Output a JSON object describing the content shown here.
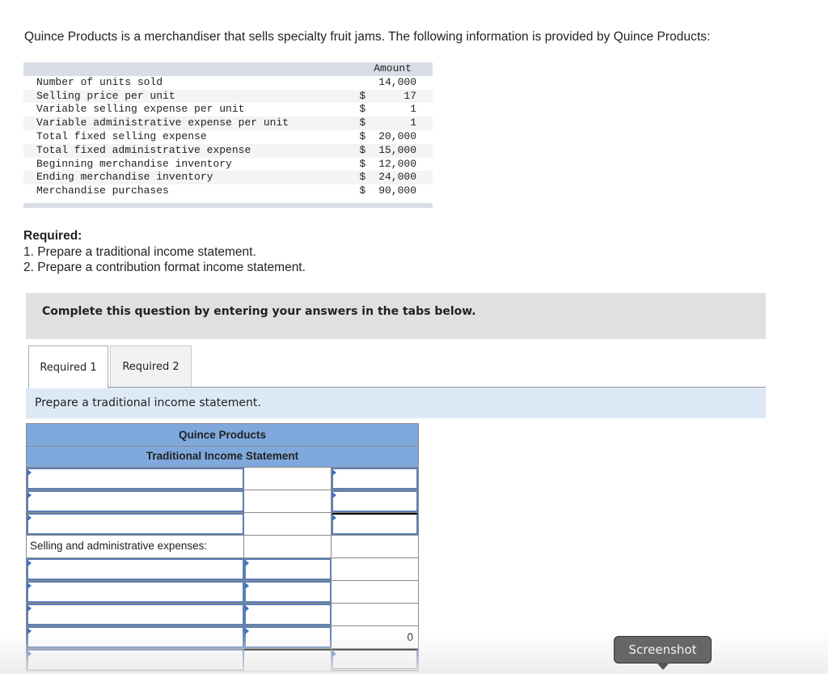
{
  "intro_text": "Quince Products is a merchandiser that sells specialty fruit jams.  The following information is provided by Quince Products:",
  "info_table": {
    "header": "Amount",
    "rows": [
      {
        "label": "Number of units sold",
        "currency": "",
        "value": "14,000"
      },
      {
        "label": "Selling price per unit",
        "currency": "$",
        "value": "17"
      },
      {
        "label": "Variable selling expense per unit",
        "currency": "$",
        "value": "1"
      },
      {
        "label": "Variable administrative expense per unit",
        "currency": "$",
        "value": "1"
      },
      {
        "label": "Total fixed selling expense",
        "currency": "$",
        "value": "20,000"
      },
      {
        "label": "Total fixed administrative expense",
        "currency": "$",
        "value": "15,000"
      },
      {
        "label": "Beginning merchandise inventory",
        "currency": "$",
        "value": "12,000"
      },
      {
        "label": "Ending merchandise inventory",
        "currency": "$",
        "value": "24,000"
      },
      {
        "label": "Merchandise purchases",
        "currency": "$",
        "value": "90,000"
      }
    ]
  },
  "required": {
    "title": "Required:",
    "items": [
      "1. Prepare a traditional income statement.",
      "2. Prepare a contribution format income statement."
    ]
  },
  "banner_text": "Complete this question by entering your answers in the tabs below.",
  "tabs": [
    {
      "label": "Required 1",
      "active": true
    },
    {
      "label": "Required 2",
      "active": false
    }
  ],
  "instruction": "Prepare a traditional income statement.",
  "statement": {
    "company": "Quince Products",
    "title": "Traditional Income Statement",
    "section_label": "Selling and administrative expenses:",
    "subtotal_value": "0"
  },
  "screenshot_button": "Screenshot"
}
